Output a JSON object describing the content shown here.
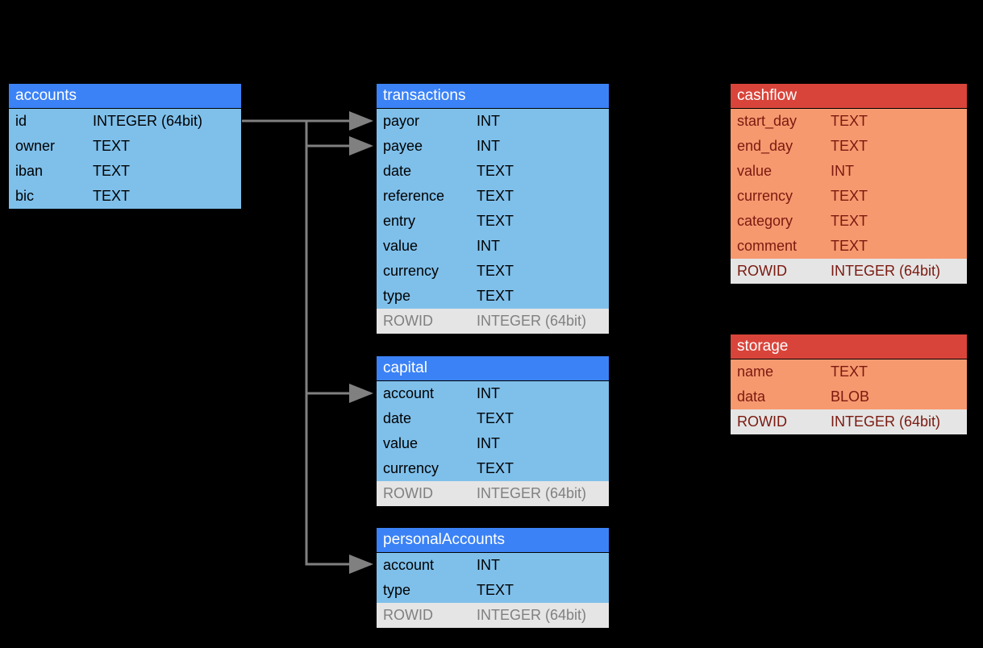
{
  "tables": {
    "accounts": {
      "title": "accounts",
      "rows": [
        {
          "name": "id",
          "type": "INTEGER (64bit)"
        },
        {
          "name": "owner",
          "type": "TEXT"
        },
        {
          "name": "iban",
          "type": "TEXT"
        },
        {
          "name": "bic",
          "type": "TEXT"
        }
      ]
    },
    "transactions": {
      "title": "transactions",
      "rows": [
        {
          "name": "payor",
          "type": "INT"
        },
        {
          "name": "payee",
          "type": "INT"
        },
        {
          "name": "date",
          "type": "TEXT"
        },
        {
          "name": "reference",
          "type": "TEXT"
        },
        {
          "name": "entry",
          "type": "TEXT"
        },
        {
          "name": "value",
          "type": "INT"
        },
        {
          "name": "currency",
          "type": "TEXT"
        },
        {
          "name": "type",
          "type": "TEXT"
        }
      ],
      "rowid": {
        "name": "ROWID",
        "type": "INTEGER (64bit)"
      }
    },
    "capital": {
      "title": "capital",
      "rows": [
        {
          "name": "account",
          "type": "INT"
        },
        {
          "name": "date",
          "type": "TEXT"
        },
        {
          "name": "value",
          "type": "INT"
        },
        {
          "name": "currency",
          "type": "TEXT"
        }
      ],
      "rowid": {
        "name": "ROWID",
        "type": "INTEGER (64bit)"
      }
    },
    "personalAccounts": {
      "title": "personalAccounts",
      "rows": [
        {
          "name": "account",
          "type": "INT"
        },
        {
          "name": "type",
          "type": "TEXT"
        }
      ],
      "rowid": {
        "name": "ROWID",
        "type": "INTEGER (64bit)"
      }
    },
    "cashflow": {
      "title": "cashflow",
      "rows": [
        {
          "name": "start_day",
          "type": "TEXT"
        },
        {
          "name": "end_day",
          "type": "TEXT"
        },
        {
          "name": "value",
          "type": "INT"
        },
        {
          "name": "currency",
          "type": "TEXT"
        },
        {
          "name": "category",
          "type": "TEXT"
        },
        {
          "name": "comment",
          "type": "TEXT"
        }
      ],
      "rowid": {
        "name": "ROWID",
        "type": "INTEGER (64bit)"
      }
    },
    "storage": {
      "title": "storage",
      "rows": [
        {
          "name": "name",
          "type": "TEXT"
        },
        {
          "name": "data",
          "type": "BLOB"
        }
      ],
      "rowid": {
        "name": "ROWID",
        "type": "INTEGER (64bit)"
      }
    }
  },
  "relations": [
    {
      "from": "accounts.id",
      "to": "transactions.payor"
    },
    {
      "from": "accounts.id",
      "to": "transactions.payee"
    },
    {
      "from": "accounts.id",
      "to": "capital.account"
    },
    {
      "from": "accounts.id",
      "to": "personalAccounts.account"
    }
  ],
  "colors": {
    "blue_header": "#3b82f6",
    "blue_body": "#7fc0eb",
    "red_header": "#d9443a",
    "orange_body": "#f7996f",
    "rowid_bg": "#e5e5e5",
    "arrow": "#808080"
  }
}
